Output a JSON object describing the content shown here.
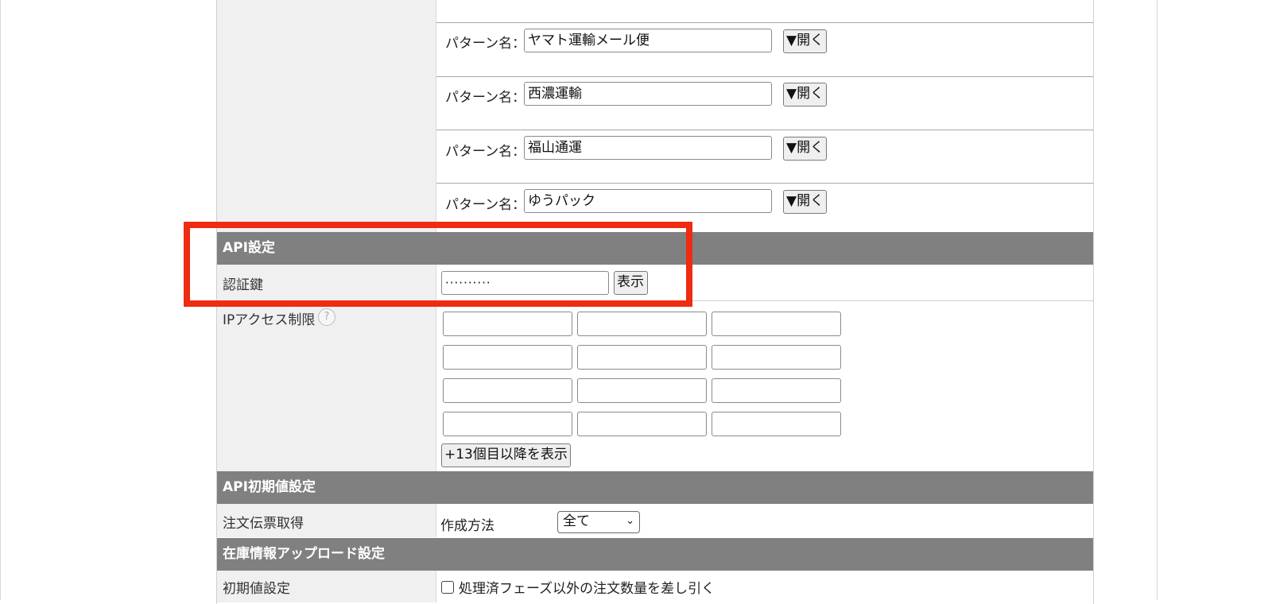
{
  "shipping_patterns": {
    "label": "パターン名：",
    "open_label": "▼開く",
    "items": [
      {
        "name": "ヤマト運輸メール便"
      },
      {
        "name": "西濃運輸"
      },
      {
        "name": "福山通運"
      },
      {
        "name": "ゆうパック"
      }
    ]
  },
  "api_settings": {
    "header": "API設定",
    "auth_key_label": "認証鍵",
    "auth_key_value": "··········",
    "show_label": "表示",
    "ip_restriction_label": "IPアクセス制限",
    "help_icon": "question-icon",
    "show_more_label": "+13個目以降を表示"
  },
  "api_defaults": {
    "header": "API初期値設定",
    "order_label": "注文伝票取得",
    "method_label": "作成方法",
    "method_value": "全て"
  },
  "inventory_upload": {
    "header": "在庫情報アップロード設定",
    "initial_label": "初期値設定",
    "checkbox_label": "処理済フェーズ以外の注文数量を差し引く"
  },
  "colors": {
    "section_header_bg": "#808080",
    "highlight_border": "#ef2b12",
    "label_col_bg": "#f0f0f0"
  }
}
